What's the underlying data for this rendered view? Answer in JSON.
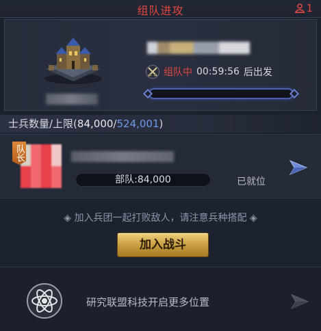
{
  "header": {
    "title": "组队进攻",
    "member_count": "1"
  },
  "target": {
    "status_label": "组队中",
    "countdown": "00:59:56",
    "depart_label": "后出发",
    "progress_fraction": 0.0
  },
  "capacity": {
    "label": "士兵数量/上限(",
    "current": "84,000",
    "separator": "/",
    "max": "524,001",
    "close": ")"
  },
  "member": {
    "leader_badge": "队长",
    "troops_label": "部队:84,000",
    "ready_status": "已就位"
  },
  "join": {
    "hint": "◈ 加入兵团一起打败敌人，请注意兵种搭配 ◈",
    "button_label": "加入战斗"
  },
  "tech": {
    "text": "研究联盟科技开启更多位置"
  },
  "icons": {
    "member": "person-icon",
    "swords": "crossed-swords-icon",
    "send": "send-arrow-icon",
    "atom": "atom-icon",
    "castle": "castle-image"
  },
  "colors": {
    "accent_red": "#e2473f",
    "accent_blue": "#6f9be8",
    "button_gold": "#d3a84c"
  }
}
